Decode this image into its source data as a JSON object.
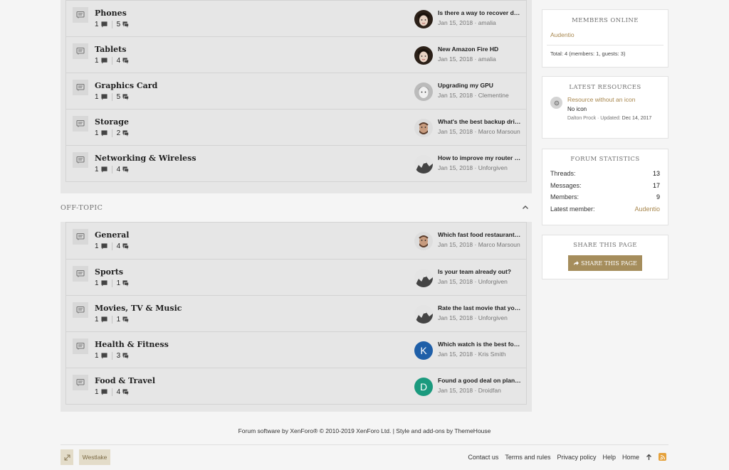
{
  "categories": [
    {
      "title": "",
      "nodes": [
        {
          "title": "Phones",
          "threads": "1",
          "messages": "5",
          "latest_title": "Is there a way to recover d…",
          "latest_meta": "Jan 15, 2018 · amalia",
          "avatar": "amalia"
        },
        {
          "title": "Tablets",
          "threads": "1",
          "messages": "4",
          "latest_title": "New Amazon Fire HD",
          "latest_meta": "Jan 15, 2018 · amalia",
          "avatar": "amalia"
        },
        {
          "title": "Graphics Card",
          "threads": "1",
          "messages": "5",
          "latest_title": "Upgrading my GPU",
          "latest_meta": "Jan 15, 2018 · Clementine",
          "avatar": "clementine"
        },
        {
          "title": "Storage",
          "threads": "1",
          "messages": "2",
          "latest_title": "What's the best backup dri…",
          "latest_meta": "Jan 15, 2018 · Marco Marsoun",
          "avatar": "marco"
        },
        {
          "title": "Networking & Wireless",
          "threads": "1",
          "messages": "4",
          "latest_title": "How to improve my router …",
          "latest_meta": "Jan 15, 2018 · Unforgiven",
          "avatar": "unforgiven"
        }
      ]
    },
    {
      "title": "OFF-TOPIC",
      "nodes": [
        {
          "title": "General",
          "threads": "1",
          "messages": "4",
          "latest_title": "Which fast food restaurant …",
          "latest_meta": "Jan 15, 2018 · Marco Marsoun",
          "avatar": "marco"
        },
        {
          "title": "Sports",
          "threads": "1",
          "messages": "1",
          "latest_title": "Is your team already out?",
          "latest_meta": "Jan 15, 2018 · Unforgiven",
          "avatar": "unforgiven"
        },
        {
          "title": "Movies, TV & Music",
          "threads": "1",
          "messages": "1",
          "latest_title": "Rate the last movie that yo…",
          "latest_meta": "Jan 15, 2018 · Unforgiven",
          "avatar": "unforgiven"
        },
        {
          "title": "Health & Fitness",
          "threads": "1",
          "messages": "3",
          "latest_title": "Which watch is the best for…",
          "latest_meta": "Jan 15, 2018 · Kris Smith",
          "avatar": "letter",
          "avatar_letter": "K",
          "avatar_color": "#1f5fa8"
        },
        {
          "title": "Food & Travel",
          "threads": "1",
          "messages": "4",
          "latest_title": "Found a good deal on plan…",
          "latest_meta": "Jan 15, 2018 · Droidfan",
          "avatar": "letter",
          "avatar_letter": "D",
          "avatar_color": "#1b9a7e"
        }
      ]
    }
  ],
  "sidebar": {
    "members_online": {
      "title": "MEMBERS ONLINE",
      "member": "Audentio",
      "total": "Total: 4 (members: 1, guests: 3)"
    },
    "latest_resources": {
      "title": "LATEST RESOURCES",
      "resource_title": "Resource without an icon",
      "resource_desc": "No icon",
      "meta_author": "Dalton Prock · Updated: ",
      "meta_date": "Dec 14, 2017"
    },
    "forum_statistics": {
      "title": "FORUM STATISTICS",
      "rows": [
        {
          "label": "Threads:",
          "value": "13"
        },
        {
          "label": "Messages:",
          "value": "17"
        },
        {
          "label": "Members:",
          "value": "9"
        },
        {
          "label": "Latest member:",
          "value": "Audentio"
        }
      ]
    },
    "share": {
      "title": "SHARE THIS PAGE",
      "button": "SHARE THIS PAGE"
    }
  },
  "footer": {
    "copyright": "Forum software by XenForo® © 2010-2019 XenForo Ltd. | Style and add-ons by ThemeHouse",
    "style_button": "Westlake",
    "links": [
      "Contact us",
      "Terms and rules",
      "Privacy policy",
      "Help",
      "Home"
    ]
  },
  "colors": {
    "accent": "#a8874e",
    "button": "#a58d5c",
    "block": "#e6e6e6",
    "rss": "#e5a23d"
  },
  "icons": [
    "forum-icon",
    "thread-icon",
    "message-icon",
    "collapse-icon",
    "gear-icon",
    "share-icon",
    "expand-icon",
    "up-arrow-icon",
    "rss-icon"
  ]
}
